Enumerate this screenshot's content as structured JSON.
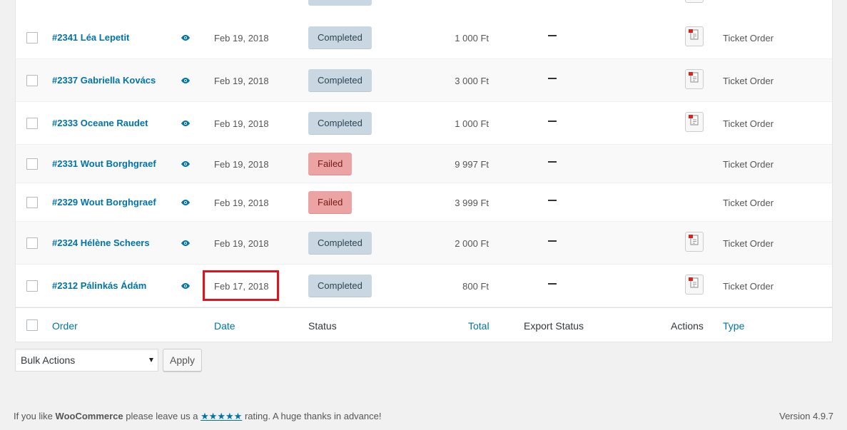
{
  "orders": [
    {
      "link": "#2341 Léa Lepetit",
      "date": "Feb 19, 2018",
      "status": "Completed",
      "total": "1 000 Ft",
      "export": "–",
      "has_action": true,
      "type": "Ticket Order"
    },
    {
      "link": "#2337 Gabriella Kovács",
      "date": "Feb 19, 2018",
      "status": "Completed",
      "total": "3 000 Ft",
      "export": "–",
      "has_action": true,
      "type": "Ticket Order"
    },
    {
      "link": "#2333 Oceane Raudet",
      "date": "Feb 19, 2018",
      "status": "Completed",
      "total": "1 000 Ft",
      "export": "–",
      "has_action": true,
      "type": "Ticket Order"
    },
    {
      "link": "#2331 Wout Borghgraef",
      "date": "Feb 19, 2018",
      "status": "Failed",
      "total": "9 997 Ft",
      "export": "–",
      "has_action": false,
      "type": "Ticket Order"
    },
    {
      "link": "#2329 Wout Borghgraef",
      "date": "Feb 19, 2018",
      "status": "Failed",
      "total": "3 999 Ft",
      "export": "–",
      "has_action": false,
      "type": "Ticket Order"
    },
    {
      "link": "#2324 Hélène Scheers",
      "date": "Feb 19, 2018",
      "status": "Completed",
      "total": "2 000 Ft",
      "export": "–",
      "has_action": true,
      "type": "Ticket Order"
    },
    {
      "link": "#2312 Pálinkás Ádám",
      "date": "Feb 17, 2018",
      "status": "Completed",
      "total": "800 Ft",
      "export": "–",
      "has_action": true,
      "type": "Ticket Order"
    }
  ],
  "columns": {
    "order": "Order",
    "date": "Date",
    "status": "Status",
    "total": "Total",
    "export_status": "Export Status",
    "actions": "Actions",
    "type": "Type"
  },
  "bulk_actions": {
    "selected": "Bulk Actions",
    "apply_label": "Apply"
  },
  "footer": {
    "text_before": "If you like ",
    "brand": "WooCommerce",
    "text_middle": " please leave us a ",
    "stars": "★★★★★",
    "text_after": " rating. A huge thanks in advance!",
    "version": "Version 4.9.7"
  },
  "colors": {
    "link": "#0073aa",
    "completed_bg": "#c8d7e1",
    "failed_bg": "#eba3a3",
    "highlight": "#e0141e"
  },
  "icons": {
    "view": "eye-icon",
    "action": "invoice-pdf-icon",
    "dropdown": "chevron-down-icon"
  }
}
